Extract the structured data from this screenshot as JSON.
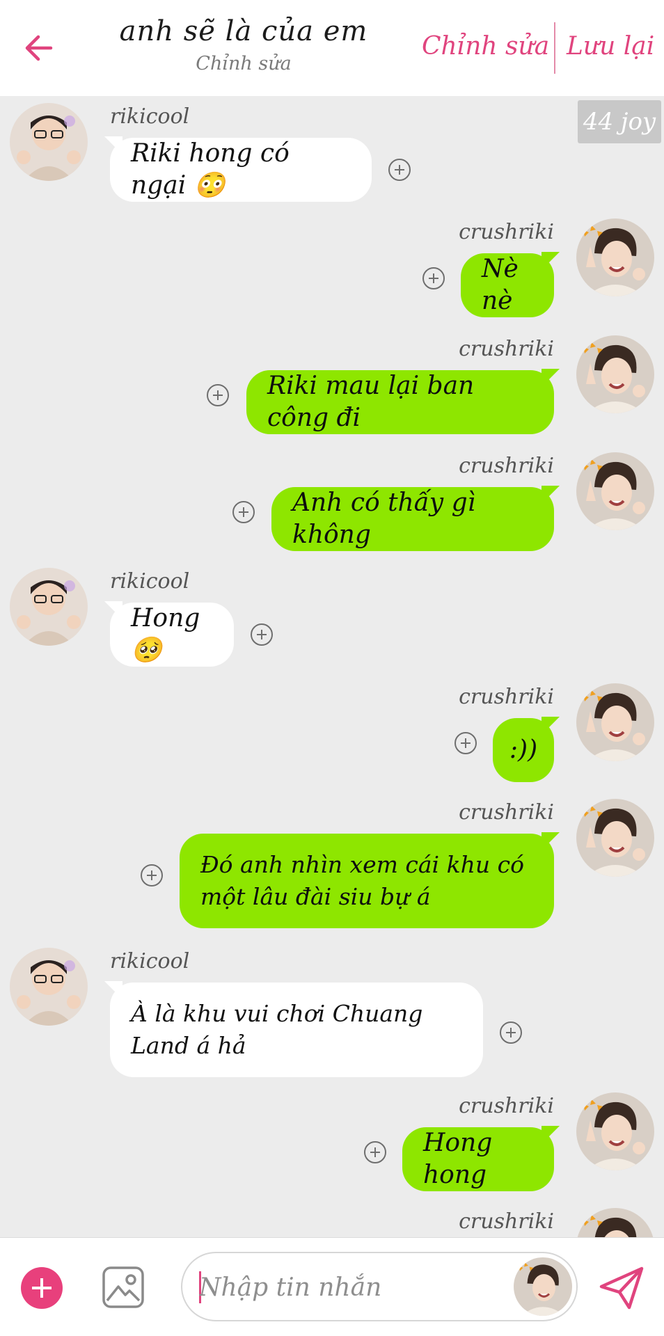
{
  "header": {
    "title": "anh sẽ là của em",
    "subtitle": "Chỉnh sửa",
    "edit_label": "Chỉnh sửa",
    "save_label": "Lưu lại",
    "accent_color": "#e0447e",
    "back_icon": "arrow-left-icon"
  },
  "chat": {
    "badge": "44 joy",
    "messages": [
      {
        "side": "left",
        "user": "rikicool",
        "text": "Riki hong có ngại 😳"
      },
      {
        "side": "right",
        "user": "crushriki",
        "text": "Nè nè"
      },
      {
        "side": "right",
        "user": "crushriki",
        "text": "Riki mau lại ban công đi"
      },
      {
        "side": "right",
        "user": "crushriki",
        "text": "Anh có thấy gì không"
      },
      {
        "side": "left",
        "user": "rikicool",
        "text": "Hong 🥺"
      },
      {
        "side": "right",
        "user": "crushriki",
        "text": ":))"
      },
      {
        "side": "right",
        "user": "crushriki",
        "text": "Đó anh nhìn xem cái khu có một lâu đài siu bự á"
      },
      {
        "side": "left",
        "user": "rikicool",
        "text": "À là khu vui chơi Chuang Land á hả"
      },
      {
        "side": "right",
        "user": "crushriki",
        "text": "Hong hong"
      },
      {
        "side": "right",
        "user": "crushriki",
        "text": ""
      }
    ],
    "sent_bubble_color": "#8ee600",
    "received_bubble_color": "#ffffff"
  },
  "composer": {
    "placeholder": "Nhập tin nhắn",
    "add_icon": "plus-icon",
    "image_icon": "image-icon",
    "send_icon": "send-icon"
  }
}
